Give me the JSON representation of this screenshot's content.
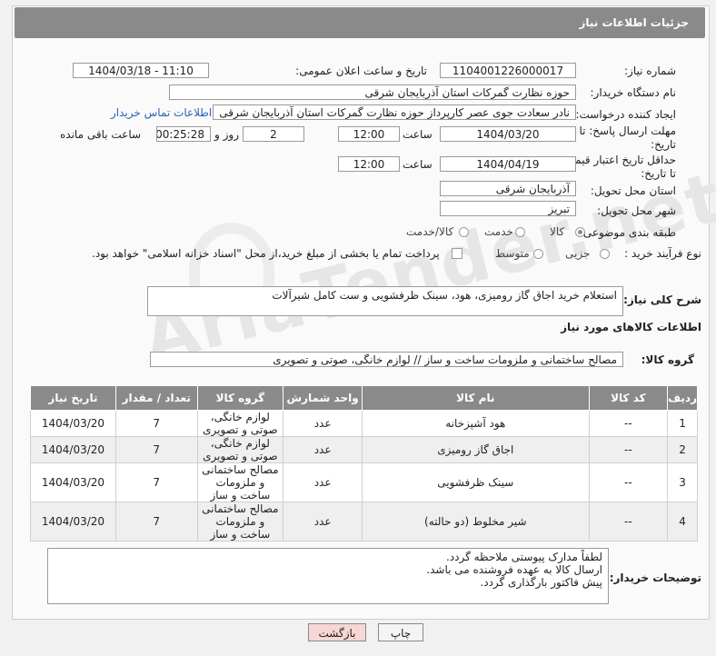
{
  "header": {
    "title": "جزئیات اطلاعات نیاز"
  },
  "form": {
    "need_number_label": "شماره نیاز:",
    "need_number": "1104001226000017",
    "announce_label": "تاریخ و ساعت اعلان عمومی:",
    "announce_value": "1404/03/18 - 11:10",
    "buyer_org_label": "نام دستگاه خریدار:",
    "buyer_org": "حوزه نظارت گمرکات استان آذربایجان شرقی",
    "creator_label": "ایجاد کننده درخواست:",
    "creator": "نادر سعادت جوی عصر کارپرداز حوزه نظارت گمرکات استان آذربایجان شرقی",
    "contact_link": "اطلاعات تماس خریدار",
    "deadline_label_1": "مهلت ارسال پاسخ: تا",
    "deadline_label_2": "تاریخ:",
    "deadline_date": "1404/03/20",
    "time_label": "ساعت",
    "deadline_time": "12:00",
    "days_value": "2",
    "days_label": "روز و",
    "remaining_time": "00:25:28",
    "remaining_label": "ساعت باقی مانده",
    "validity_label_1": "حداقل تاریخ اعتبار قیمت:",
    "validity_label_2": "تا تاریخ:",
    "validity_date": "1404/04/19",
    "validity_time": "12:00",
    "province_label": "استان محل تحویل:",
    "province": "آذربایجان شرقی",
    "city_label": "شهر محل تحویل:",
    "city": "تبریز",
    "category_label": "طبقه بندی موضوعی:",
    "category_options": [
      "کالا",
      "خدمت",
      "کالا/خدمت"
    ],
    "process_label": "نوع فرآیند خرید :",
    "process_options": [
      "جزیی",
      "متوسط"
    ],
    "payment_note": "پرداخت تمام یا بخشی از مبلغ خرید،از محل \"اسناد خزانه اسلامی\" خواهد بود."
  },
  "description": {
    "label": "شرح کلی نیاز:",
    "text": "استعلام خرید اجاق گاز رومیزی، هود، سینک ظرفشویی و ست کامل شیرآلات"
  },
  "goods": {
    "section_title": "اطلاعات کالاهای مورد نیاز",
    "group_label": "گروه کالا:",
    "group_value": "مصالح ساختمانی و ملزومات ساخت و ساز // لوازم خانگی، صوتی و تصویری",
    "columns": [
      "ردیف",
      "کد کالا",
      "نام کالا",
      "واحد شمارش",
      "گروه کالا",
      "تعداد / مقدار",
      "تاریخ نیاز"
    ],
    "rows": [
      {
        "index": "1",
        "code": "--",
        "name": "هود آشپزخانه",
        "unit": "عدد",
        "group": "لوازم خانگی، صوتی و تصویری",
        "qty": "7",
        "date": "1404/03/20"
      },
      {
        "index": "2",
        "code": "--",
        "name": "اجاق گاز رومیزی",
        "unit": "عدد",
        "group": "لوازم خانگی، صوتی و تصویری",
        "qty": "7",
        "date": "1404/03/20"
      },
      {
        "index": "3",
        "code": "--",
        "name": "سینک ظرفشویی",
        "unit": "عدد",
        "group": "مصالح ساختمانی و ملزومات ساخت و ساز",
        "qty": "7",
        "date": "1404/03/20"
      },
      {
        "index": "4",
        "code": "--",
        "name": "شیر مخلوط (دو حالته)",
        "unit": "عدد",
        "group": "مصالح ساختمانی و ملزومات ساخت و ساز",
        "qty": "7",
        "date": "1404/03/20"
      }
    ]
  },
  "buyer_notes": {
    "label": "توضیحات خریدار:",
    "line1": "لطفاً مدارک پیوستی ملاحظه گردد.",
    "line2": "ارسال کالا به عهده فروشنده می باشد.",
    "line3": "پیش فاکتور بارگذاری گردد."
  },
  "buttons": {
    "print": "چاپ",
    "back": "بازگشت"
  },
  "watermark": "AriaTender.net"
}
